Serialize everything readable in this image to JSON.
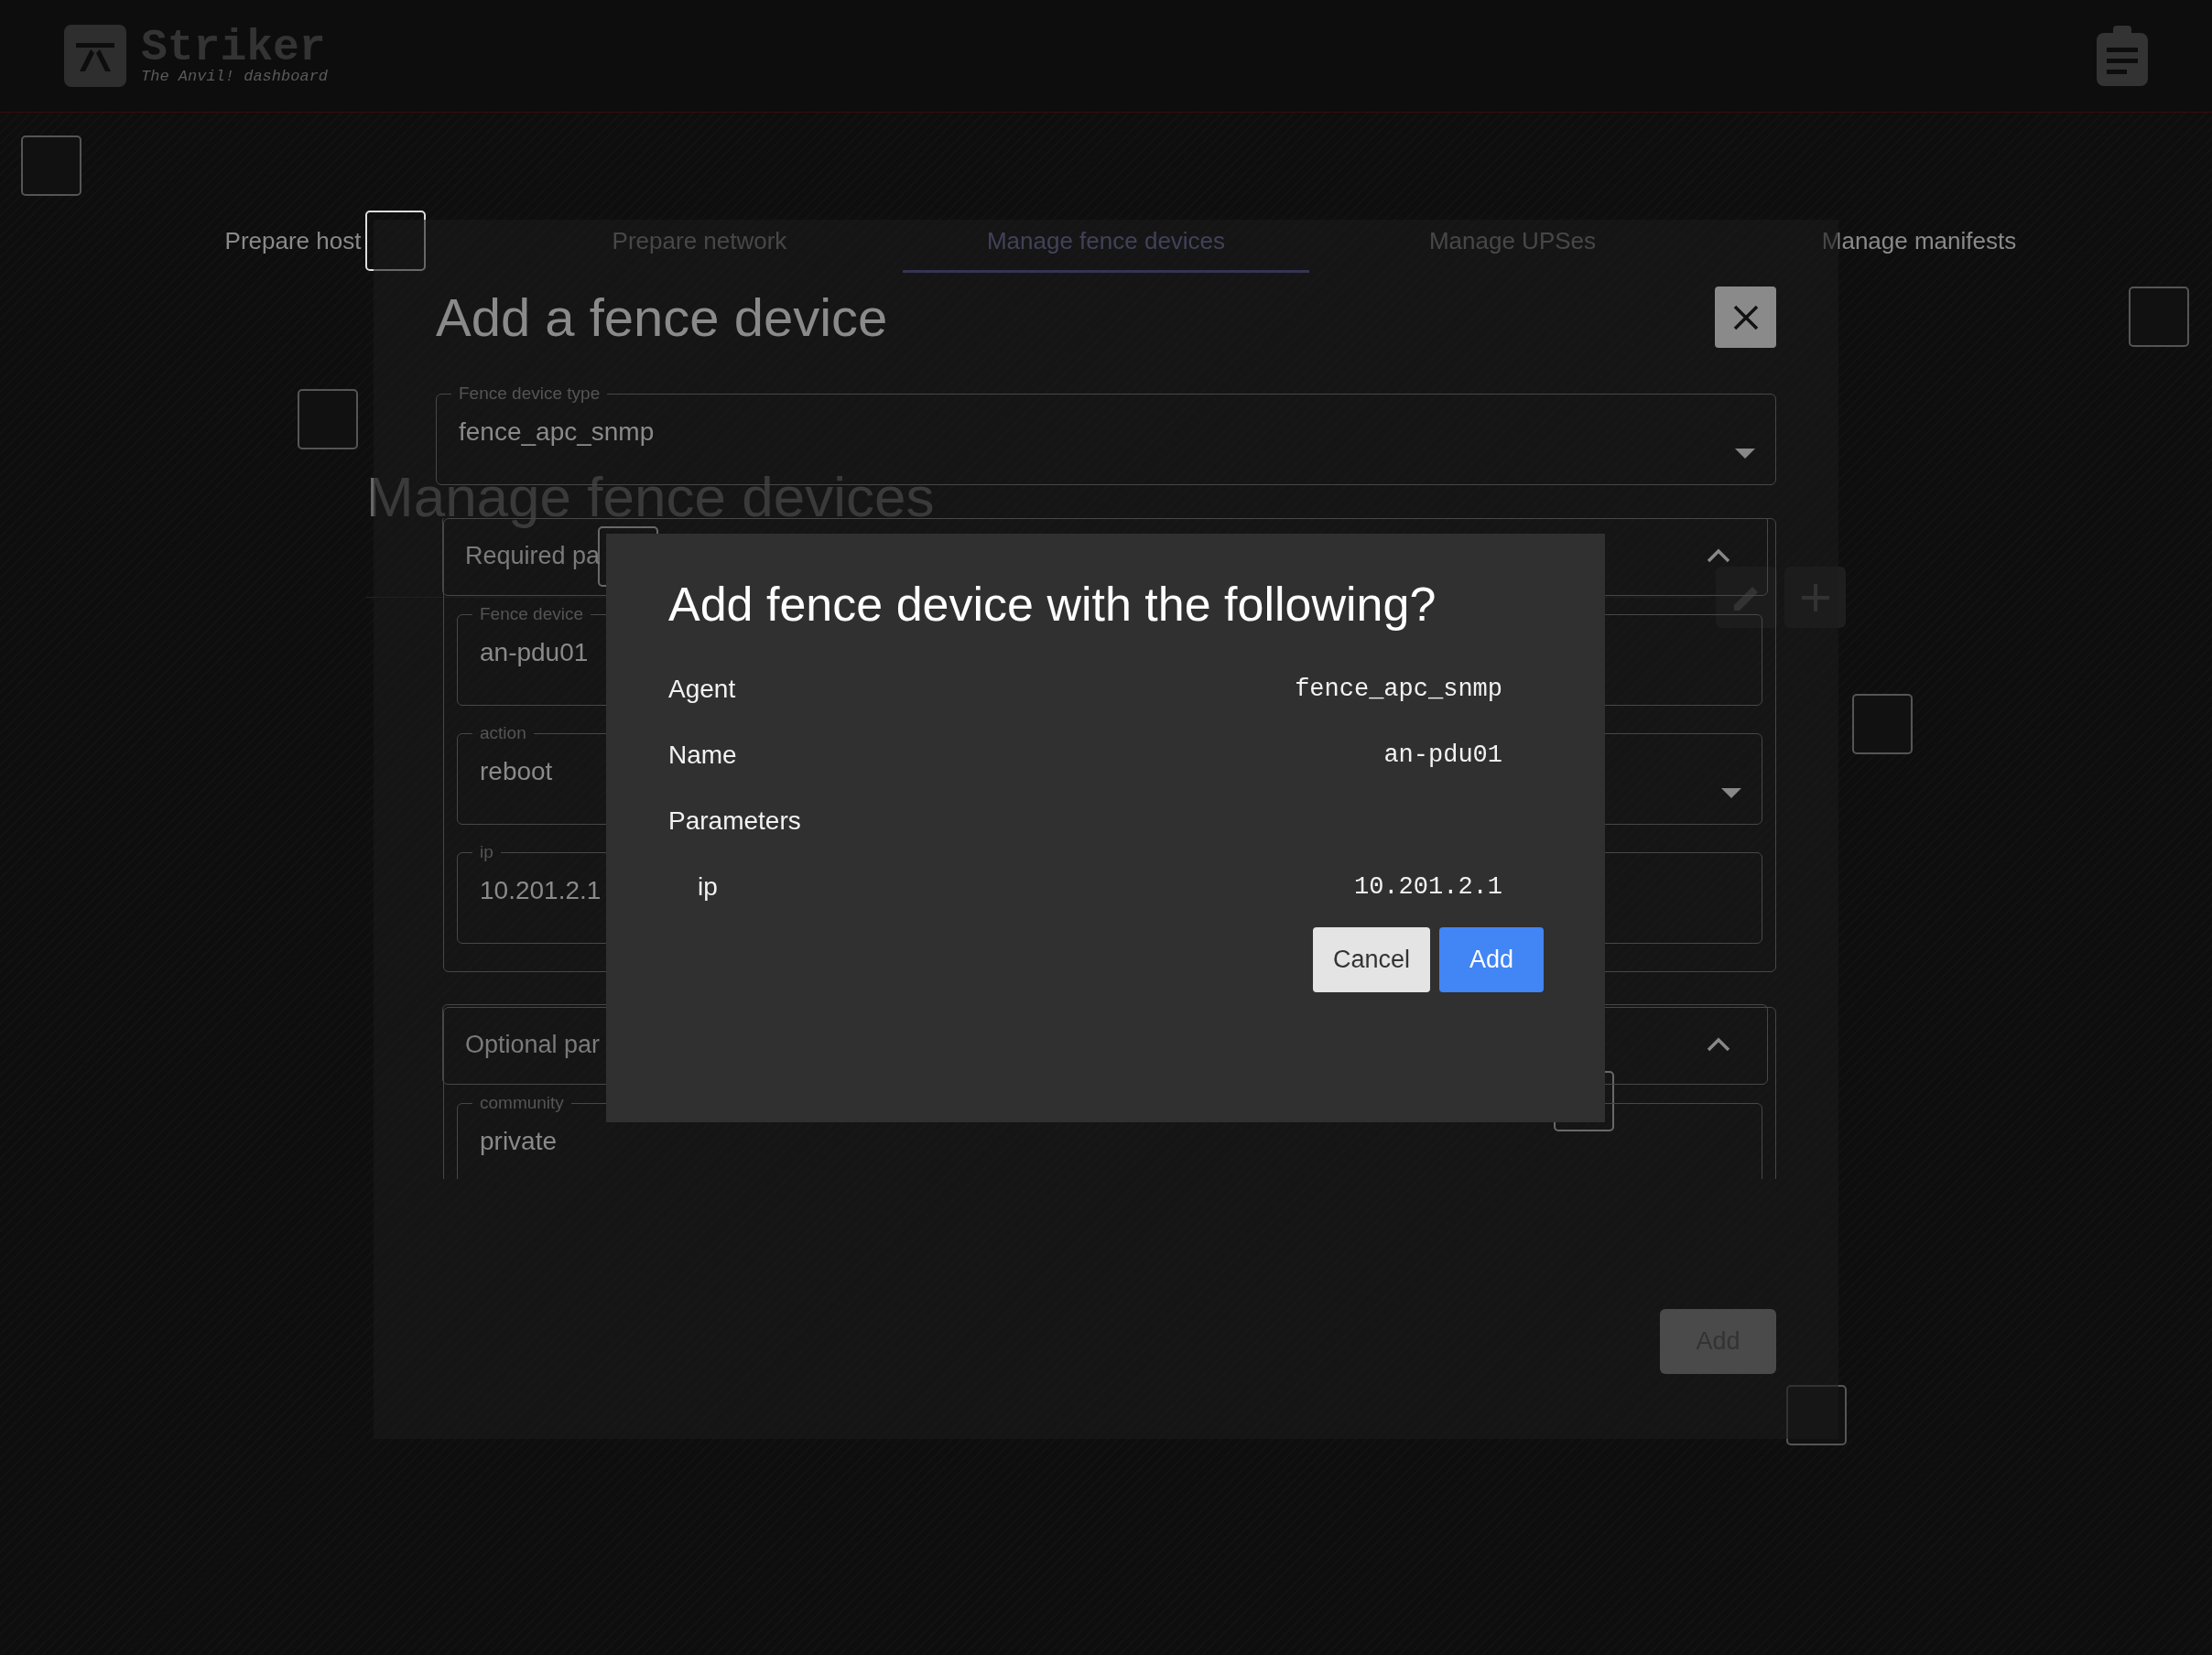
{
  "header": {
    "title": "Striker",
    "subtitle": "The Anvil! dashboard"
  },
  "tabs": [
    {
      "label": "Prepare host",
      "selected": false
    },
    {
      "label": "Prepare network",
      "selected": false
    },
    {
      "label": "Manage fence devices",
      "selected": true
    },
    {
      "label": "Manage UPSes",
      "selected": false
    },
    {
      "label": "Manage manifests",
      "selected": false
    }
  ],
  "page": {
    "heading": "Manage fence devices"
  },
  "dialog": {
    "title": "Add a fence device",
    "type_field": {
      "label": "Fence device type",
      "value": "fence_apc_snmp",
      "kind": "select"
    },
    "sections": [
      {
        "title": "Required pa",
        "expanded": true,
        "fields": [
          {
            "label": "Fence device",
            "value": "an-pdu01",
            "kind": "text"
          },
          {
            "label": "action",
            "value": "reboot",
            "kind": "select"
          },
          {
            "label": "ip",
            "value": "10.201.2.1",
            "kind": "text"
          }
        ]
      },
      {
        "title": "Optional par",
        "expanded": true,
        "fields": [
          {
            "label": "community",
            "value": "private",
            "kind": "text"
          }
        ]
      }
    ],
    "submit": {
      "label": "Add",
      "disabled": true
    }
  },
  "confirm": {
    "title": "Add fence device with the following?",
    "rows": [
      {
        "label": "Agent",
        "value": "fence_apc_snmp",
        "kind": "item"
      },
      {
        "label": "Name",
        "value": "an-pdu01",
        "kind": "item"
      },
      {
        "label": "Parameters",
        "kind": "heading"
      },
      {
        "label": "ip",
        "value": "10.201.2.1",
        "kind": "param"
      }
    ],
    "buttons": [
      {
        "label": "Cancel",
        "kind": "secondary"
      },
      {
        "label": "Add",
        "kind": "primary"
      }
    ]
  }
}
